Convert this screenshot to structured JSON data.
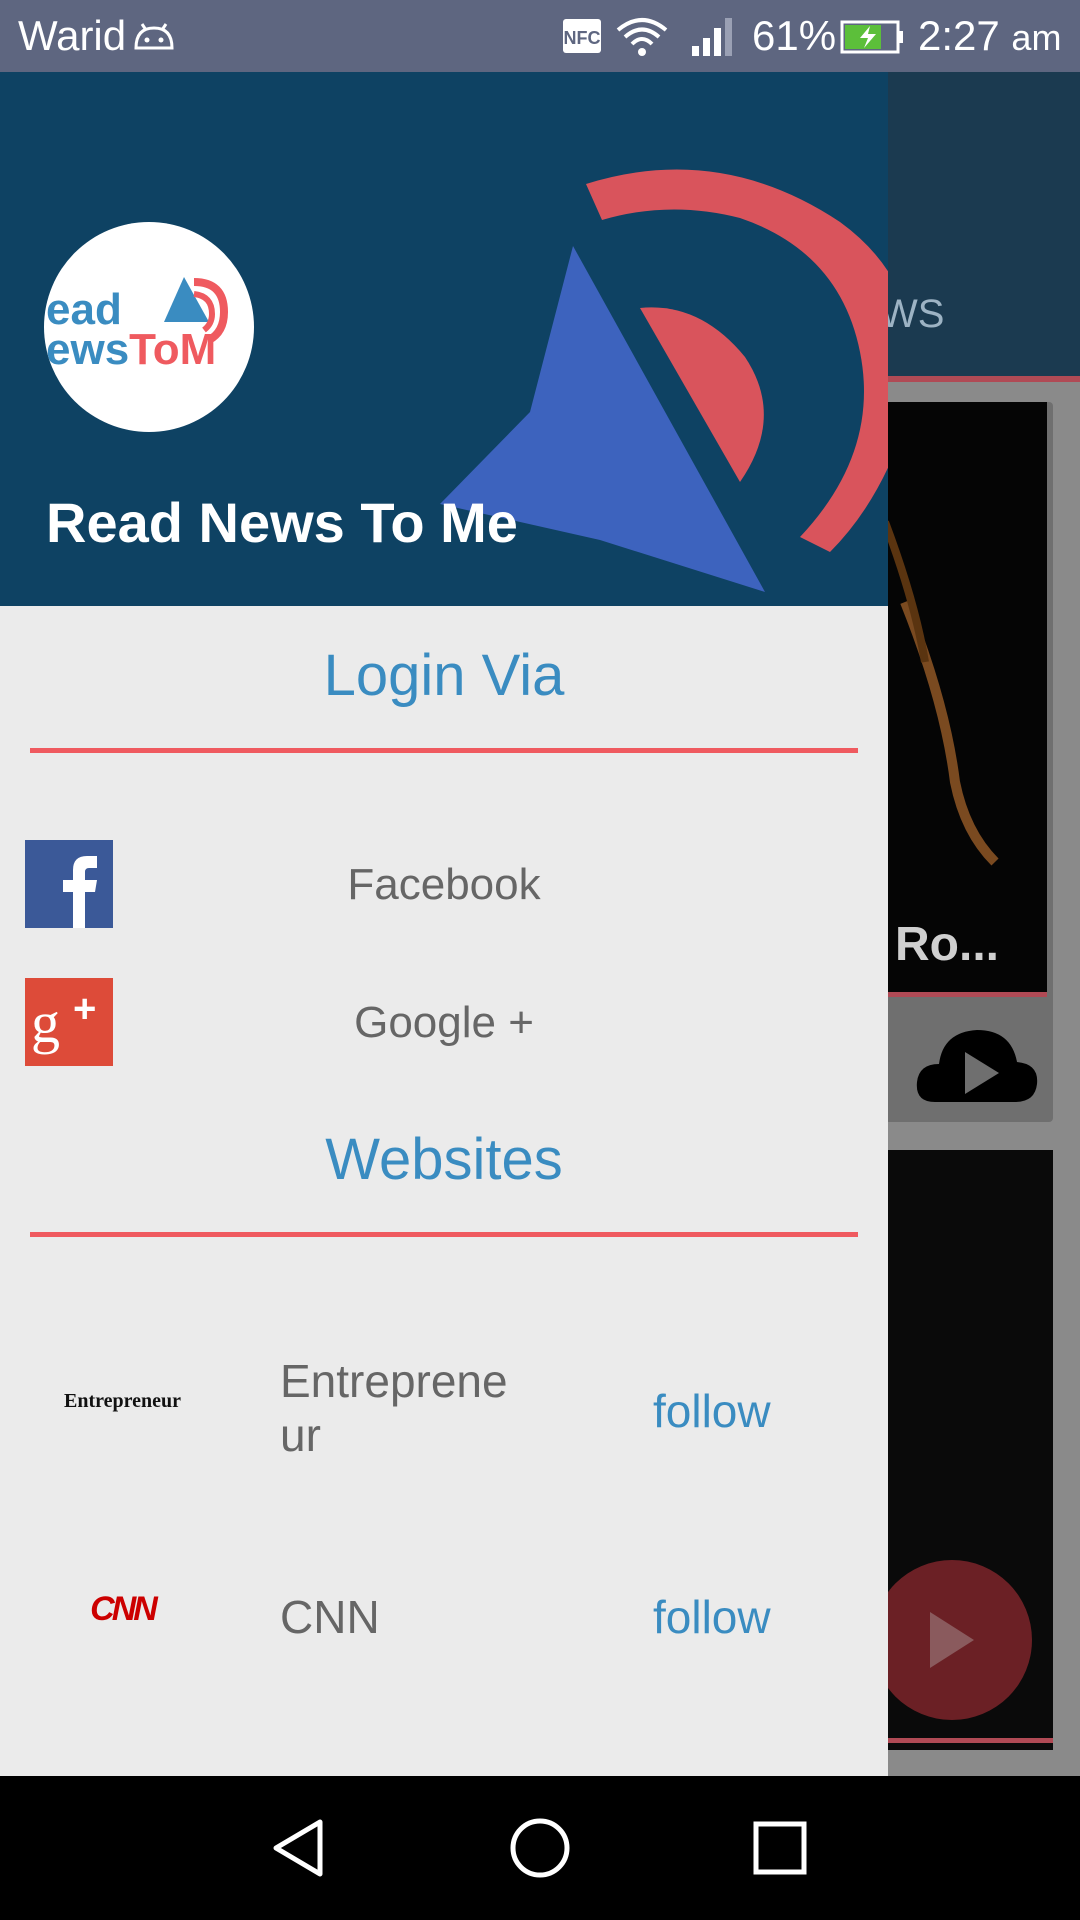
{
  "status_bar": {
    "carrier": "Warid",
    "nfc": "NFC",
    "battery_percent": "61%",
    "time": "2:27",
    "ampm": "am",
    "icons": [
      "android-debug-icon",
      "nfc-icon",
      "wifi-icon",
      "signal-icon",
      "battery-charging-icon"
    ]
  },
  "background_app": {
    "tab_fragment": "WS",
    "card_title_fragment": "Ro..."
  },
  "drawer": {
    "app_name": "Read News To Me",
    "logo_text_line1": "ead",
    "logo_text_line2a": "ews",
    "logo_text_line2b": "ToM",
    "login_title": "Login Via",
    "login_options": [
      {
        "label": "Facebook",
        "icon": "facebook-icon"
      },
      {
        "label": "Google +",
        "icon": "google-plus-icon"
      }
    ],
    "websites_title": "Websites",
    "websites": [
      {
        "logo_text": "Entrepreneur",
        "name_line1": "Entreprene",
        "name_line2": "ur",
        "action": "follow"
      },
      {
        "logo_text": "CNN",
        "name": "CNN",
        "action": "follow"
      }
    ]
  },
  "colors": {
    "header_bg": "#0e4263",
    "accent_blue": "#3a8cc1",
    "accent_red": "#ef5a5f",
    "speaker_blue": "#3d63be",
    "speaker_red": "#d9545c",
    "drawer_bg": "#ebebeb"
  },
  "nav_bar": {
    "buttons": [
      "back-icon",
      "home-icon",
      "recents-icon"
    ]
  }
}
